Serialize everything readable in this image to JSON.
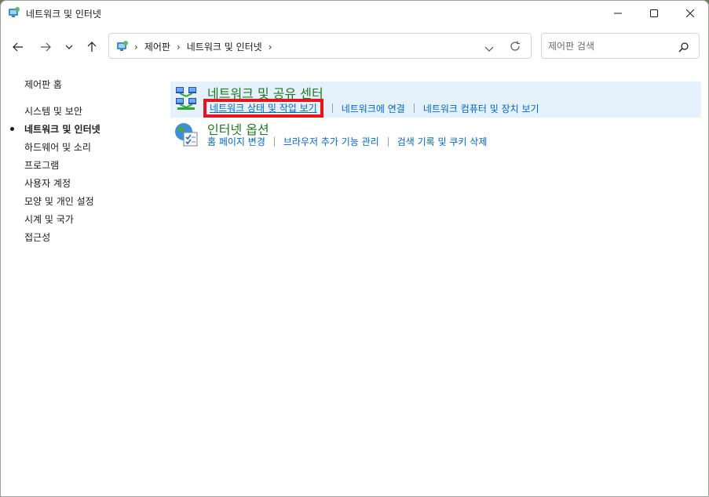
{
  "window": {
    "title": "네트워크 및 인터넷"
  },
  "address_bar": {
    "crumbs": [
      "제어판",
      "네트워크 및 인터넷"
    ]
  },
  "search": {
    "placeholder": "제어판 검색"
  },
  "sidebar": {
    "home": "제어판 홈",
    "items": [
      {
        "label": "시스템 및 보안",
        "active": false
      },
      {
        "label": "네트워크 및 인터넷",
        "active": true
      },
      {
        "label": "하드웨어 및 소리",
        "active": false
      },
      {
        "label": "프로그램",
        "active": false
      },
      {
        "label": "사용자 계정",
        "active": false
      },
      {
        "label": "모양 및 개인 설정",
        "active": false
      },
      {
        "label": "시계 및 국가",
        "active": false
      },
      {
        "label": "접근성",
        "active": false
      }
    ]
  },
  "categories": [
    {
      "title": "네트워크 및 공유 센터",
      "icon": "network-icon",
      "links": [
        "네트워크 상태 및 작업 보기",
        "네트워크에 연결",
        "네트워크 컴퓨터 및 장치 보기"
      ]
    },
    {
      "title": "인터넷 옵션",
      "icon": "internet-options-icon",
      "links": [
        "홈 페이지 변경",
        "브라우저 추가 기능 관리",
        "검색 기록 및 쿠키 삭제"
      ]
    }
  ],
  "colors": {
    "link": "#0066cc",
    "category_title": "#1e7a1e",
    "highlight_bg": "#e5f1fb",
    "annotation_box": "#e8141c"
  }
}
